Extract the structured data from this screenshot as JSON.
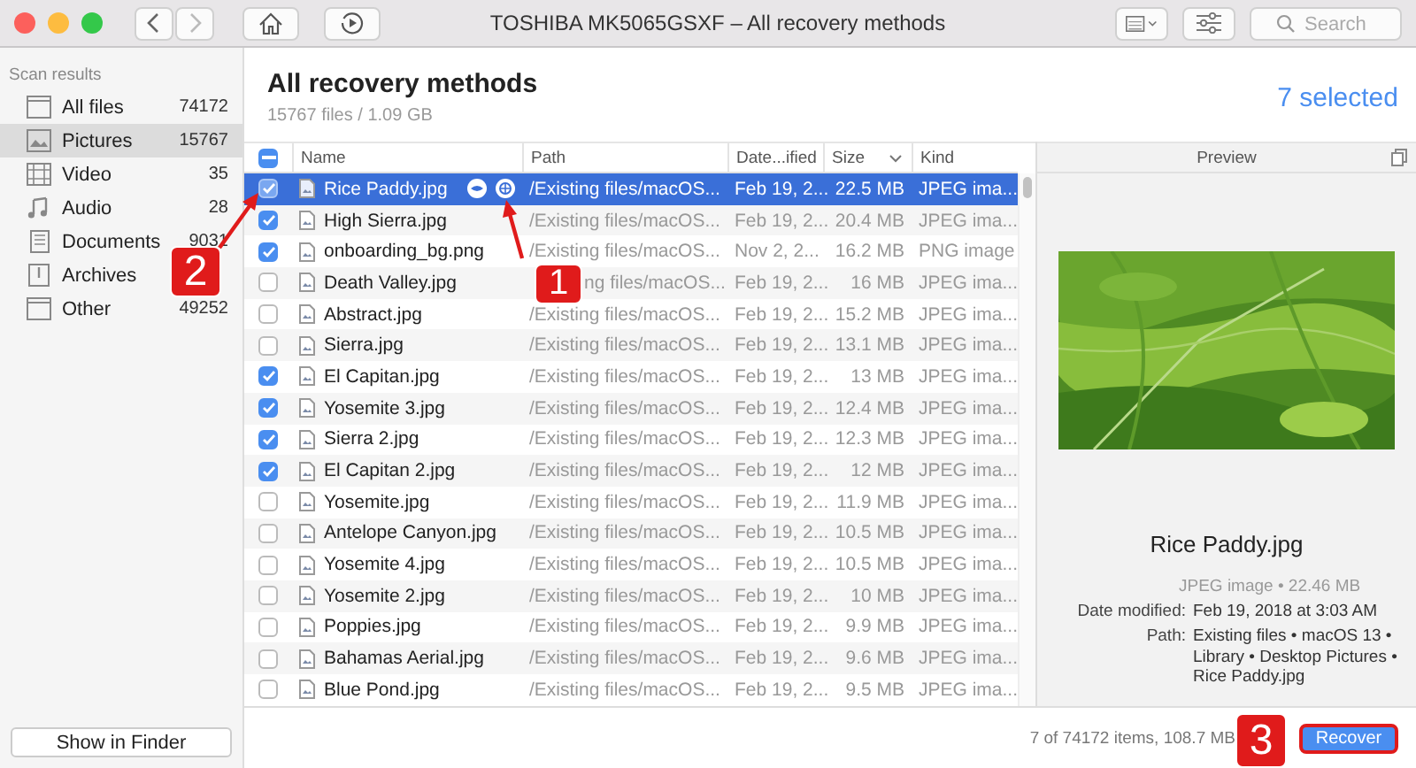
{
  "window": {
    "title": "TOSHIBA MK5065GSXF – All recovery methods"
  },
  "search": {
    "placeholder": "Search"
  },
  "sidebar": {
    "heading": "Scan results",
    "items": [
      {
        "label": "All files",
        "count": "74172",
        "kind": "files",
        "selected": false
      },
      {
        "label": "Pictures",
        "count": "15767",
        "kind": "pictures",
        "selected": true
      },
      {
        "label": "Video",
        "count": "35",
        "kind": "video",
        "selected": false
      },
      {
        "label": "Audio",
        "count": "28",
        "kind": "audio",
        "selected": false
      },
      {
        "label": "Documents",
        "count": "9031",
        "kind": "documents",
        "selected": false
      },
      {
        "label": "Archives",
        "kind": "archives",
        "selected": false
      },
      {
        "label": "Other",
        "count": "49252",
        "kind": "other",
        "selected": false
      }
    ],
    "button": "Show in Finder"
  },
  "header": {
    "title": "All recovery methods",
    "subtitle": "15767 files / 1.09 GB",
    "selected_count": "7 selected"
  },
  "table": {
    "select_all_partial": true,
    "columns": [
      "Name",
      "Path",
      "Date...ified",
      "Size",
      "Kind"
    ],
    "rows": [
      {
        "name": "Rice Paddy.jpg",
        "path": "/Existing files/macOS...",
        "date": "Feb 19, 2...",
        "size": "22.5 MB",
        "kind": "JPEG ima...",
        "checked": true,
        "selected": true
      },
      {
        "name": "High Sierra.jpg",
        "path": "/Existing files/macOS...",
        "date": "Feb 19, 2...",
        "size": "20.4 MB",
        "kind": "JPEG ima...",
        "checked": true,
        "selected": false
      },
      {
        "name": "onboarding_bg.png",
        "path": "/Existing files/macOS...",
        "date": "Nov 2, 2...",
        "size": "16.2 MB",
        "kind": "PNG image",
        "checked": true,
        "selected": false
      },
      {
        "name": "Death Valley.jpg",
        "path": "ng files/macOS...",
        "date": "Feb 19, 2...",
        "size": "16 MB",
        "kind": "JPEG ima...",
        "checked": false,
        "selected": false
      },
      {
        "name": "Abstract.jpg",
        "path": "/Existing files/macOS...",
        "date": "Feb 19, 2...",
        "size": "15.2 MB",
        "kind": "JPEG ima...",
        "checked": false,
        "selected": false
      },
      {
        "name": "Sierra.jpg",
        "path": "/Existing files/macOS...",
        "date": "Feb 19, 2...",
        "size": "13.1 MB",
        "kind": "JPEG ima...",
        "checked": false,
        "selected": false
      },
      {
        "name": "El Capitan.jpg",
        "path": "/Existing files/macOS...",
        "date": "Feb 19, 2...",
        "size": "13 MB",
        "kind": "JPEG ima...",
        "checked": true,
        "selected": false
      },
      {
        "name": "Yosemite 3.jpg",
        "path": "/Existing files/macOS...",
        "date": "Feb 19, 2...",
        "size": "12.4 MB",
        "kind": "JPEG ima...",
        "checked": true,
        "selected": false
      },
      {
        "name": "Sierra 2.jpg",
        "path": "/Existing files/macOS...",
        "date": "Feb 19, 2...",
        "size": "12.3 MB",
        "kind": "JPEG ima...",
        "checked": true,
        "selected": false
      },
      {
        "name": "El Capitan 2.jpg",
        "path": "/Existing files/macOS...",
        "date": "Feb 19, 2...",
        "size": "12 MB",
        "kind": "JPEG ima...",
        "checked": true,
        "selected": false
      },
      {
        "name": "Yosemite.jpg",
        "path": "/Existing files/macOS...",
        "date": "Feb 19, 2...",
        "size": "11.9 MB",
        "kind": "JPEG ima...",
        "checked": false,
        "selected": false
      },
      {
        "name": "Antelope Canyon.jpg",
        "path": "/Existing files/macOS...",
        "date": "Feb 19, 2...",
        "size": "10.5 MB",
        "kind": "JPEG ima...",
        "checked": false,
        "selected": false
      },
      {
        "name": "Yosemite 4.jpg",
        "path": "/Existing files/macOS...",
        "date": "Feb 19, 2...",
        "size": "10.5 MB",
        "kind": "JPEG ima...",
        "checked": false,
        "selected": false
      },
      {
        "name": "Yosemite 2.jpg",
        "path": "/Existing files/macOS...",
        "date": "Feb 19, 2...",
        "size": "10 MB",
        "kind": "JPEG ima...",
        "checked": false,
        "selected": false
      },
      {
        "name": "Poppies.jpg",
        "path": "/Existing files/macOS...",
        "date": "Feb 19, 2...",
        "size": "9.9 MB",
        "kind": "JPEG ima...",
        "checked": false,
        "selected": false
      },
      {
        "name": "Bahamas Aerial.jpg",
        "path": "/Existing files/macOS...",
        "date": "Feb 19, 2...",
        "size": "9.6 MB",
        "kind": "JPEG ima...",
        "checked": false,
        "selected": false
      },
      {
        "name": "Blue Pond.jpg",
        "path": "/Existing files/macOS...",
        "date": "Feb 19, 2...",
        "size": "9.5 MB",
        "kind": "JPEG ima...",
        "checked": false,
        "selected": false
      }
    ]
  },
  "preview": {
    "heading": "Preview",
    "filename": "Rice Paddy.jpg",
    "kind_size": "JPEG image • 22.46 MB",
    "details": [
      {
        "label": "Date modified:",
        "value": "Feb 19, 2018 at 3:03 AM"
      },
      {
        "label": "Path:",
        "value": "Existing files • macOS 13 • Library • Desktop Pictures • Rice Paddy.jpg"
      }
    ]
  },
  "footer": {
    "status": "7 of 74172 items, 108.7 MB",
    "button": "Recover"
  },
  "callouts": [
    "1",
    "2",
    "3"
  ]
}
